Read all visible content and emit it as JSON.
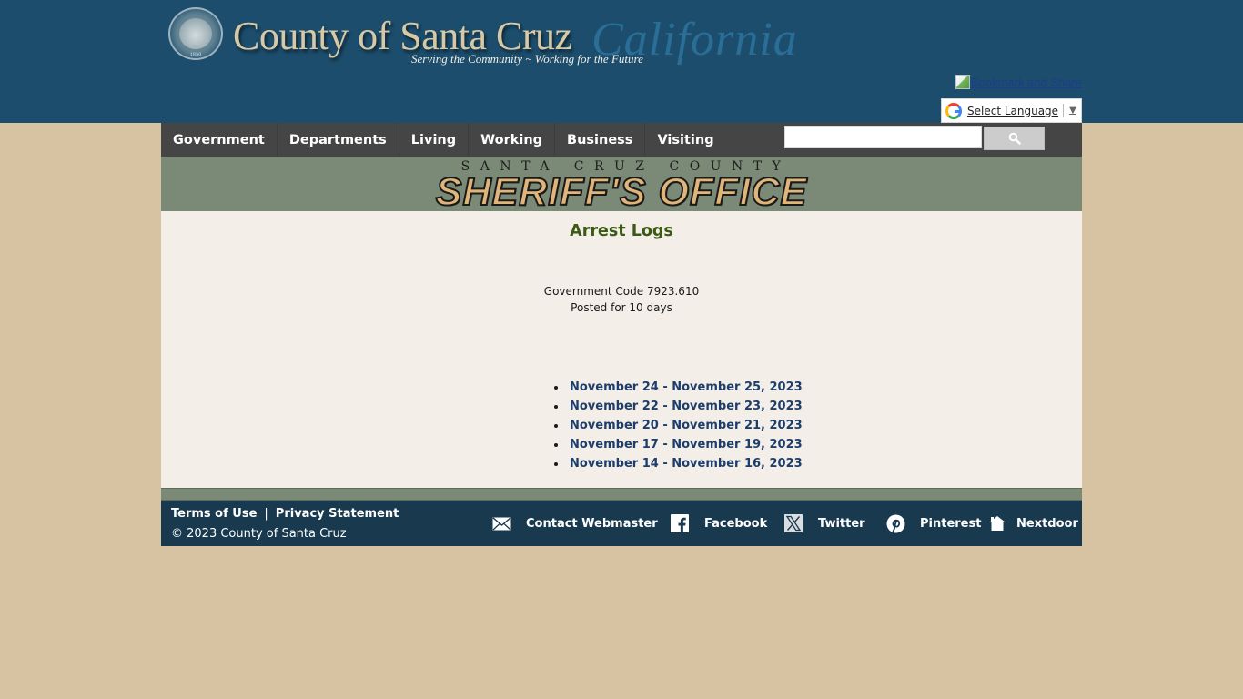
{
  "header": {
    "site_title": "County of Santa Cruz",
    "site_california": "California",
    "tagline": "Serving the Community ~ Working for the Future",
    "seal_year": "1850",
    "bookmark_label": "Bookmark and Share",
    "language_select_label": "Select Language"
  },
  "nav": {
    "items": [
      {
        "label": "Government"
      },
      {
        "label": "Departments"
      },
      {
        "label": "Living"
      },
      {
        "label": "Working"
      },
      {
        "label": "Business"
      },
      {
        "label": "Visiting"
      }
    ],
    "search": {
      "value": "",
      "placeholder": ""
    }
  },
  "banner": {
    "top_line": "SANTA CRUZ COUNTY",
    "main_line": "SHERIFF'S OFFICE"
  },
  "content": {
    "title": "Arrest Logs",
    "info_line1": "Government Code 7923.610",
    "info_line2": "Posted for 10 days",
    "logs": [
      {
        "label": "November 24 - November 25, 2023"
      },
      {
        "label": "November 22 - November 23, 2023"
      },
      {
        "label": "November 20 - November 21, 2023"
      },
      {
        "label": "November 17 - November 19, 2023"
      },
      {
        "label": "November 14 - November 16, 2023"
      }
    ]
  },
  "footer": {
    "terms_label": "Terms of Use",
    "separator": "|",
    "privacy_label": "Privacy Statement",
    "copyright": "© 2023 County of Santa Cruz",
    "social": [
      {
        "label": "Contact Webmaster",
        "icon": "mail-icon"
      },
      {
        "label": "Facebook",
        "icon": "facebook-icon"
      },
      {
        "label": "Twitter",
        "icon": "x-twitter-icon"
      },
      {
        "label": "Pinterest",
        "icon": "pinterest-icon"
      },
      {
        "label": "Nextdoor",
        "icon": "nextdoor-icon"
      }
    ]
  },
  "colors": {
    "header_bg": "#1c4d6c",
    "page_bg": "#d7c2a2",
    "nav_bg": "#454545",
    "banner_bg": "#7a8a76",
    "content_bg": "#f4eee8",
    "title_color": "#3a5a16",
    "link_color": "#1d3d6b",
    "footer_bg": "#18394e"
  }
}
